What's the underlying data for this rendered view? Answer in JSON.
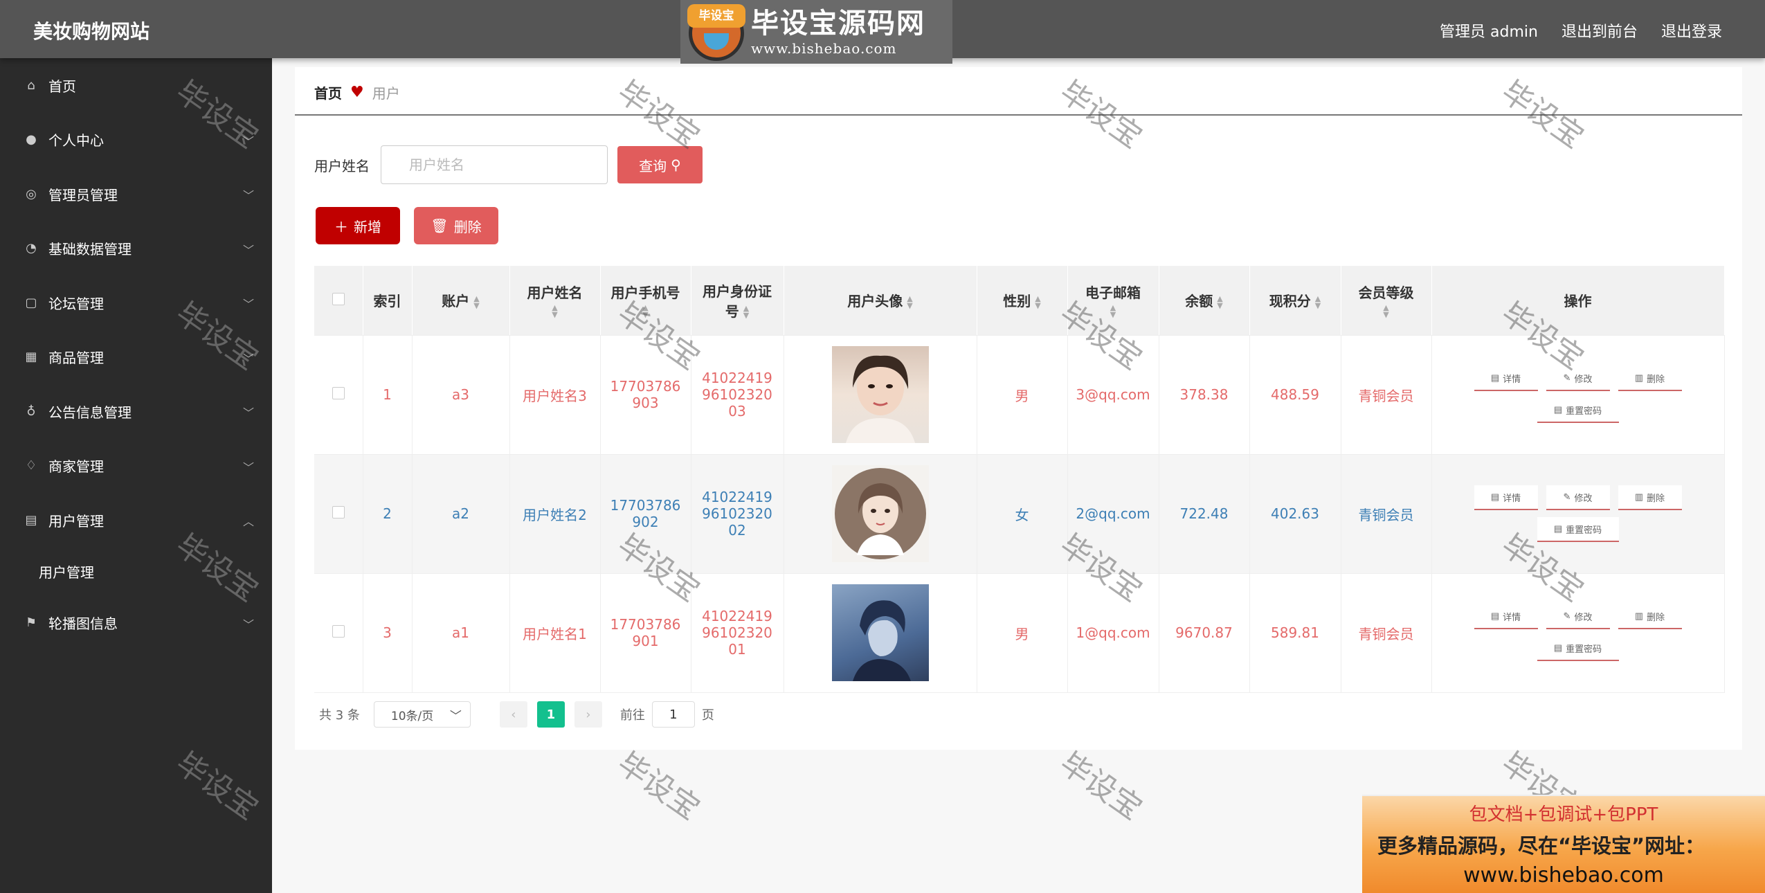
{
  "header": {
    "site_title": "美妆购物网站",
    "admin_label": "管理员 admin",
    "back_to_front": "退出到前台",
    "logout": "退出登录",
    "logo_badge": "毕设宝",
    "logo_name": "毕设宝源码网",
    "logo_url": "www.bishebao.com"
  },
  "sidebar": {
    "items": [
      {
        "label": "首页",
        "icon": "home-icon"
      },
      {
        "label": "个人中心",
        "icon": "user-icon"
      },
      {
        "label": "管理员管理",
        "icon": "admin-icon"
      },
      {
        "label": "基础数据管理",
        "icon": "data-icon"
      },
      {
        "label": "论坛管理",
        "icon": "forum-icon"
      },
      {
        "label": "商品管理",
        "icon": "grid-icon"
      },
      {
        "label": "公告信息管理",
        "icon": "mic-icon"
      },
      {
        "label": "商家管理",
        "icon": "bell-off-icon"
      },
      {
        "label": "用户管理",
        "icon": "message-icon"
      },
      {
        "label": "轮播图信息",
        "icon": "flag-icon"
      }
    ],
    "sub_item": "用户管理"
  },
  "breadcrumb": {
    "home": "首页",
    "current": "用户"
  },
  "search": {
    "label": "用户姓名",
    "placeholder": "用户姓名",
    "button": "查询"
  },
  "actions": {
    "add": "新增",
    "delete": "删除"
  },
  "table": {
    "headers": {
      "index": "索引",
      "account": "账户",
      "name": "用户姓名",
      "phone": "用户手机号",
      "idcard_1": "用户身份证",
      "idcard_2": "号",
      "avatar": "用户头像",
      "gender": "性别",
      "email": "电子邮箱",
      "balance": "余额",
      "points": "现积分",
      "level": "会员等级",
      "ops": "操作"
    },
    "rows": [
      {
        "index": "1",
        "account": "a3",
        "name": "用户姓名3",
        "phone_1": "17703786",
        "phone_2": "903",
        "id_1": "41022419",
        "id_2": "96102320",
        "id_3": "03",
        "gender": "男",
        "email": "3@qq.com",
        "balance": "378.38",
        "points": "488.59",
        "level": "青铜会员"
      },
      {
        "index": "2",
        "account": "a2",
        "name": "用户姓名2",
        "phone_1": "17703786",
        "phone_2": "902",
        "id_1": "41022419",
        "id_2": "96102320",
        "id_3": "02",
        "gender": "女",
        "email": "2@qq.com",
        "balance": "722.48",
        "points": "402.63",
        "level": "青铜会员"
      },
      {
        "index": "3",
        "account": "a1",
        "name": "用户姓名1",
        "phone_1": "17703786",
        "phone_2": "901",
        "id_1": "41022419",
        "id_2": "96102320",
        "id_3": "01",
        "gender": "男",
        "email": "1@qq.com",
        "balance": "9670.87",
        "points": "589.81",
        "level": "青铜会员"
      }
    ],
    "op_labels": {
      "detail": "详情",
      "edit": "修改",
      "delete": "删除",
      "reset": "重置密码"
    }
  },
  "pagination": {
    "total": "共 3 条",
    "page_size": "10条/页",
    "current": "1",
    "goto_prefix": "前往",
    "goto_value": "1",
    "goto_suffix": "页"
  },
  "watermark": "毕设宝",
  "ad": {
    "line1": "包文档+包调试+包PPT",
    "line2": "更多精品源码，尽在“毕设宝”网址：",
    "line3": "www.bishebao.com"
  },
  "colors": {
    "header_bg": "#555555",
    "sidebar_bg": "#2b2b2b",
    "primary_red": "#c00000",
    "accent_red": "#e15c5c",
    "row_text_red": "#e46a6a",
    "row_text_blue": "#3d7fb5",
    "pager_active": "#13c08e"
  }
}
